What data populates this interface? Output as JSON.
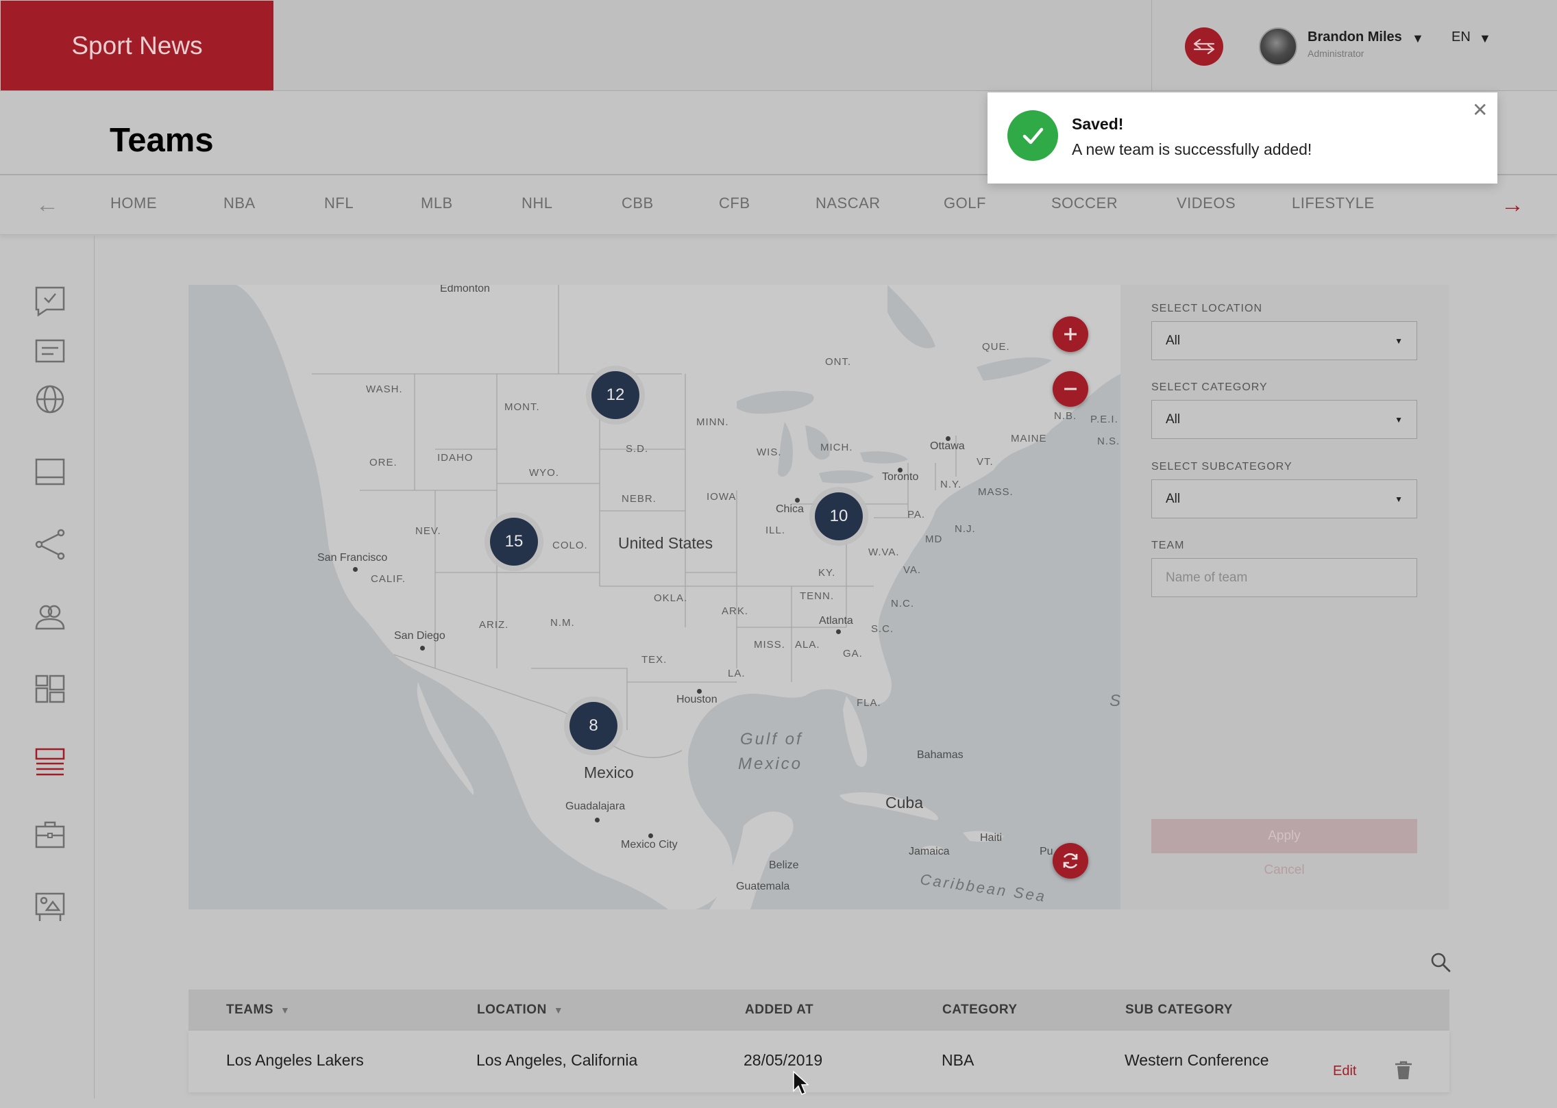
{
  "app": {
    "brand": "Sport News"
  },
  "user": {
    "name": "Brandon Miles",
    "role": "Administrator"
  },
  "language": {
    "selected": "EN"
  },
  "page": {
    "title": "Teams"
  },
  "nav": {
    "items": [
      "HOME",
      "NBA",
      "NFL",
      "MLB",
      "NHL",
      "CBB",
      "CFB",
      "NASCAR",
      "GOLF",
      "SOCCER",
      "VIDEOS",
      "LIFESTYLE"
    ]
  },
  "sidebar": {
    "icons": [
      "checklist-icon",
      "article-icon",
      "globe-icon",
      "layout-icon",
      "share-icon",
      "users-icon",
      "dashboard-icon",
      "list-icon",
      "briefcase-icon",
      "media-icon"
    ],
    "active": "list-icon"
  },
  "map": {
    "clusters": [
      {
        "count": "12"
      },
      {
        "count": "15"
      },
      {
        "count": "10"
      },
      {
        "count": "8"
      }
    ],
    "labels": {
      "edmonton": "Edmonton",
      "wash": "WASH.",
      "mont": "MONT.",
      "idaho": "IDAHO",
      "ore": "ORE.",
      "wyo": "WYO.",
      "sd": "S.D.",
      "minn": "MINN.",
      "wis": "WIS.",
      "mich": "MICH.",
      "ont": "ONT.",
      "que": "QUE.",
      "ottawa": "Ottawa",
      "toronto": "Toronto",
      "maine": "MAINE",
      "nb": "N.B.",
      "pei": "P.E.I.",
      "ns": "N.S.",
      "vt": "VT.",
      "ny": "N.Y.",
      "mass": "MASS.",
      "pa": "PA.",
      "nj": "N.J.",
      "md": "MD",
      "va": "VA.",
      "wva": "W.VA.",
      "nebr": "NEBR.",
      "iowa": "IOWA",
      "chicago": "Chica",
      "ill": "ILL.",
      "nev": "NEV.",
      "colo": "COLO.",
      "us": "United States",
      "sf": "San Francisco",
      "calif": "CALIF.",
      "ky": "KY.",
      "okla": "OKLA.",
      "tenn": "TENN.",
      "ark": "ARK.",
      "nc": "N.C.",
      "atlanta": "Atlanta",
      "sc": "S.C.",
      "ariz": "ARIZ.",
      "nm": "N.M.",
      "sandiego": "San Diego",
      "miss": "MISS.",
      "ala": "ALA.",
      "ga": "GA.",
      "tex": "TEX.",
      "la": "LA.",
      "houston": "Houston",
      "fla": "FLA.",
      "gulf1": "Gulf of",
      "gulf2": "Mexico",
      "bahamas": "Bahamas",
      "mexico": "Mexico",
      "cuba": "Cuba",
      "guadalajara": "Guadalajara",
      "mexicocity": "Mexico City",
      "belize": "Belize",
      "jamaica": "Jamaica",
      "haiti": "Haiti",
      "puerto": "Pu",
      "guatemala": "Guatemala",
      "caribbean": "Caribbean Sea",
      "s": "S"
    }
  },
  "filters": {
    "location": {
      "label": "SELECT LOCATION",
      "value": "All"
    },
    "category": {
      "label": "SELECT CATEGORY",
      "value": "All"
    },
    "subcategory": {
      "label": "SELECT SUBCATEGORY",
      "value": "All"
    },
    "team": {
      "label": "TEAM",
      "placeholder": "Name of team"
    },
    "apply": "Apply",
    "cancel": "Cancel"
  },
  "table": {
    "columns": [
      "TEAMS",
      "LOCATION",
      "ADDED AT",
      "CATEGORY",
      "SUB CATEGORY"
    ],
    "rows": [
      {
        "team": "Los Angeles Lakers",
        "location": "Los Angeles, California",
        "added_at": "28/05/2019",
        "category": "NBA",
        "sub_category": "Western Conference",
        "edit": "Edit"
      }
    ]
  },
  "toast": {
    "title": "Saved!",
    "message": "A new team is successfully added!"
  },
  "colors": {
    "brand": "#a01c27",
    "success": "#2faa46",
    "cluster": "#25334a"
  }
}
